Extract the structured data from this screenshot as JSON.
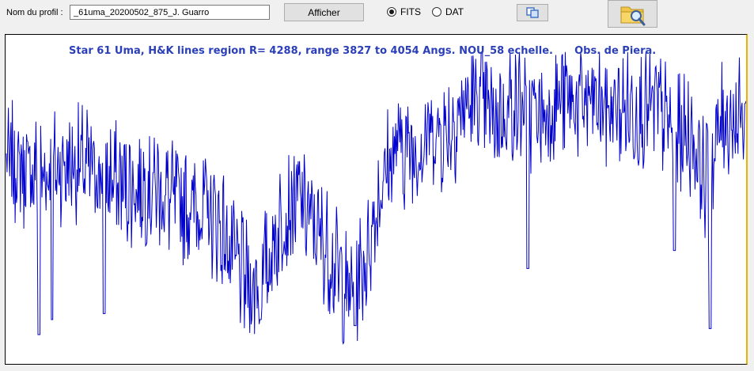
{
  "toolbar": {
    "profile_label": "Nom du profil :",
    "profile_value": "_61uma_20200502_875_J. Guarro",
    "display_label": "Afficher",
    "format_options": [
      {
        "label": "FITS",
        "selected": true
      },
      {
        "label": "DAT",
        "selected": false
      }
    ],
    "copy_icon": "copy-icon",
    "open_icon": "folder-search-icon"
  },
  "colors": {
    "spectrum_line": "#0000cc",
    "title_text": "#2a3fb8",
    "plot_right_border": "#e8b400"
  },
  "plot": {
    "title": "Star 61 Uma, H&K lines region R= 4288, range 3827 to 4054 Angs. NOU_58 echelle.      Obs. de Piera."
  },
  "chart_data": {
    "type": "line",
    "x_range": [
      3827,
      4054
    ],
    "x_unit": "Angs.",
    "axes_shown": false,
    "grid": false,
    "envelope": [
      [
        3827,
        0.62
      ],
      [
        3832,
        0.6
      ],
      [
        3837,
        0.58
      ],
      [
        3842,
        0.6
      ],
      [
        3847,
        0.62
      ],
      [
        3852,
        0.6
      ],
      [
        3857,
        0.58
      ],
      [
        3862,
        0.55
      ],
      [
        3867,
        0.54
      ],
      [
        3872,
        0.55
      ],
      [
        3877,
        0.5
      ],
      [
        3882,
        0.48
      ],
      [
        3887,
        0.48
      ],
      [
        3892,
        0.42
      ],
      [
        3897,
        0.3
      ],
      [
        3902,
        0.2
      ],
      [
        3907,
        0.28
      ],
      [
        3912,
        0.45
      ],
      [
        3917,
        0.5
      ],
      [
        3922,
        0.4
      ],
      [
        3927,
        0.3
      ],
      [
        3932,
        0.18
      ],
      [
        3937,
        0.28
      ],
      [
        3942,
        0.55
      ],
      [
        3947,
        0.68
      ],
      [
        3952,
        0.66
      ],
      [
        3957,
        0.72
      ],
      [
        3962,
        0.72
      ],
      [
        3967,
        0.8
      ],
      [
        3972,
        0.84
      ],
      [
        3977,
        0.76
      ],
      [
        3982,
        0.82
      ],
      [
        3987,
        0.8
      ],
      [
        3992,
        0.78
      ],
      [
        3997,
        0.84
      ],
      [
        4002,
        0.82
      ],
      [
        4007,
        0.82
      ],
      [
        4012,
        0.8
      ],
      [
        4017,
        0.8
      ],
      [
        4022,
        0.8
      ],
      [
        4027,
        0.8
      ],
      [
        4032,
        0.72
      ],
      [
        4037,
        0.72
      ],
      [
        4042,
        0.55
      ],
      [
        4047,
        0.78
      ],
      [
        4054,
        0.76
      ]
    ],
    "dips": [
      [
        3837,
        0.05
      ],
      [
        3841,
        0.1
      ],
      [
        3857,
        0.12
      ],
      [
        3905,
        0.1
      ],
      [
        3934,
        0.08
      ],
      [
        3987,
        0.27
      ],
      [
        4032,
        0.33
      ],
      [
        4043,
        0.07
      ]
    ]
  }
}
